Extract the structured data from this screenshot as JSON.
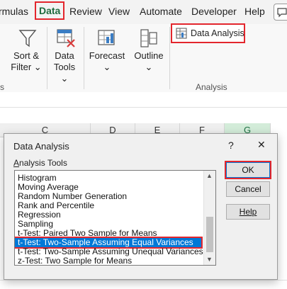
{
  "ribbon": {
    "tabs": [
      "rmulas",
      "Data",
      "Review",
      "View",
      "Automate",
      "Developer",
      "Help"
    ],
    "sort_filter": [
      "Sort &",
      "Filter"
    ],
    "data_tools": [
      "Data",
      "Tools"
    ],
    "forecast": "Forecast",
    "outline": "Outline",
    "data_analysis": "Data Analysis",
    "group_analysis": "Analysis",
    "chevron": "⌄",
    "left_group_fragment": "s"
  },
  "sheet": {
    "columns": [
      "C",
      "D",
      "E",
      "F",
      "G"
    ]
  },
  "dialog": {
    "title": "Data Analysis",
    "help_symbol": "?",
    "close_symbol": "✕",
    "tools_label": "Analysis Tools",
    "items": [
      "Histogram",
      "Moving Average",
      "Random Number Generation",
      "Rank and Percentile",
      "Regression",
      "Sampling",
      "t-Test: Paired Two Sample for Means",
      "t-Test: Two-Sample Assuming Equal Variances",
      "t-Test: Two-Sample Assuming Unequal Variances",
      "z-Test: Two Sample for Means"
    ],
    "selected_index": 7,
    "ok_label": "OK",
    "cancel_label": "Cancel",
    "help_label": "Help"
  },
  "colors": {
    "highlight": "#e3262d",
    "selection": "#0078d7",
    "excel_green": "#217346"
  },
  "icons": [
    "filter-icon",
    "data-tools-icon",
    "forecast-sheet-icon",
    "outline-icon",
    "data-analysis-icon"
  ]
}
